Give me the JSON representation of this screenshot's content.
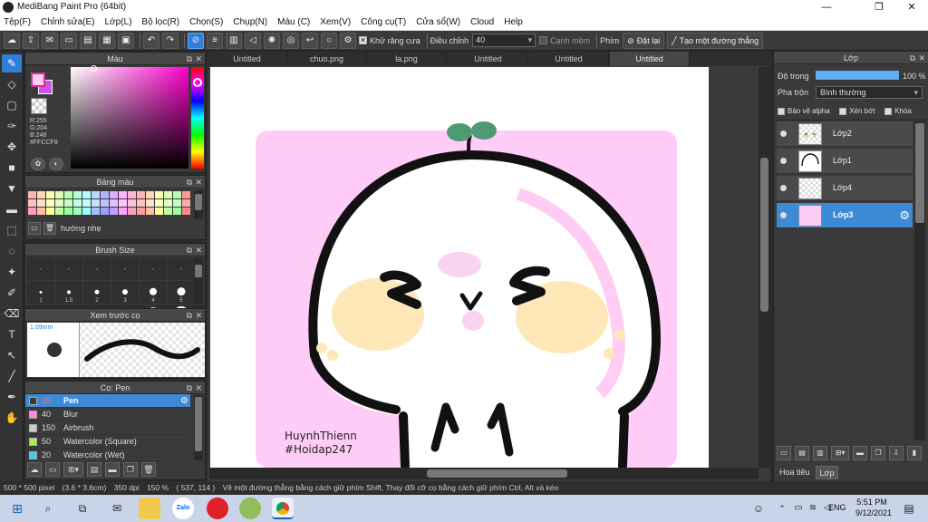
{
  "window": {
    "title": "MediBang Paint Pro (64bit)",
    "minimize": "—",
    "maximize": "❐",
    "close": "✕"
  },
  "menu": [
    "Tệp(F)",
    "Chỉnh sửa(E)",
    "Lớp(L)",
    "Bộ lọc(R)",
    "Chọn(S)",
    "Chụp(N)",
    "Màu (C)",
    "Xem(V)",
    "Công cụ(T)",
    "Cửa sổ(W)",
    "Cloud",
    "Help"
  ],
  "toolbar": {
    "antialias_label": "Khử răng cưa",
    "adjust_label": "Điều chỉnh",
    "adjust_value": "40",
    "snap_label": "Cạnh mềm",
    "snap_prefix": "Phím",
    "reset_label": "Đặt lại",
    "line_label": "Tạo một đường thẳng"
  },
  "color_panel": {
    "title": "Màu",
    "r": "R:255",
    "g": "G:204",
    "b": "B:248",
    "hex": "#FFCCF8",
    "fg_color": "#ffccf8"
  },
  "palette_panel": {
    "title": "Bảng màu",
    "name": "hướng nhẹ",
    "colors": [
      "#ffb3b3",
      "#ffd9b3",
      "#ffffb3",
      "#d9ffb3",
      "#b3ffb3",
      "#b3ffd9",
      "#b3ffff",
      "#b3d9ff",
      "#b3b3ff",
      "#d9b3ff",
      "#ffb3ff",
      "#ffb3d9",
      "#ffb3b3",
      "#ffd9b3",
      "#ffffb3",
      "#d9ffb3",
      "#b3ffb3",
      "#ff9999",
      "#ffc2c2",
      "#ffe0c2",
      "#ffffc2",
      "#e0ffc2",
      "#c2ffc2",
      "#c2ffe0",
      "#c2ffff",
      "#c2e0ff",
      "#c2c2ff",
      "#e0c2ff",
      "#ffc2ff",
      "#ffc2e0",
      "#ffc2c2",
      "#ffe0c2",
      "#ffffc2",
      "#e0ffc2",
      "#c2ffc2",
      "#ffaaaa",
      "#ff9fbf",
      "#ffbf9f",
      "#ffff9f",
      "#bfff9f",
      "#9fff9f",
      "#9fffbf",
      "#9fffff",
      "#9fbfff",
      "#9f9fff",
      "#bf9fff",
      "#ff9fff",
      "#ff9fbf",
      "#ff9f9f",
      "#ffbf9f",
      "#ffff9f",
      "#bfff9f",
      "#9fff9f",
      "#ff8888"
    ]
  },
  "brushsize_panel": {
    "title": "Brush Size",
    "sizes": [
      {
        "label": "",
        "d": 1
      },
      {
        "label": "",
        "d": 1
      },
      {
        "label": "",
        "d": 1
      },
      {
        "label": "",
        "d": 1
      },
      {
        "label": "",
        "d": 1
      },
      {
        "label": "",
        "d": 1
      },
      {
        "label": "1",
        "d": 3
      },
      {
        "label": "1.5",
        "d": 4
      },
      {
        "label": "2",
        "d": 5
      },
      {
        "label": "3",
        "d": 6
      },
      {
        "label": "4",
        "d": 8
      },
      {
        "label": "5",
        "d": 9
      },
      {
        "label": "",
        "d": 10
      },
      {
        "label": "",
        "d": 11
      },
      {
        "label": "",
        "d": 12
      },
      {
        "label": "",
        "d": 13
      },
      {
        "label": "",
        "d": 15
      },
      {
        "label": "",
        "d": 17
      }
    ]
  },
  "preview_panel": {
    "title": "Xem trước cọ",
    "size": "1.09mm"
  },
  "brush_panel": {
    "title": "Cọ: Pen",
    "items": [
      {
        "size": "15",
        "name": "Pen",
        "color": "#3a3a3a",
        "selected": true
      },
      {
        "size": "40",
        "name": "Blur",
        "color": "#ff88dd",
        "selected": false
      },
      {
        "size": "150",
        "name": "Airbrush",
        "color": "#cccccc",
        "selected": false
      },
      {
        "size": "50",
        "name": "Watercolor (Square)",
        "color": "#aaee55",
        "selected": false
      },
      {
        "size": "20",
        "name": "Watercolor (Wet)",
        "color": "#44ccee",
        "selected": false
      }
    ]
  },
  "tabs": [
    "Untitled",
    "chuo.png",
    "la.png",
    "Untitled",
    "Untitled",
    "Untitled"
  ],
  "active_tab": 5,
  "canvas": {
    "signature_line1": "HuynhThienn",
    "signature_line2": "#Hoidap247"
  },
  "layer_panel": {
    "title": "Lớp",
    "opacity_label": "Độ trong",
    "opacity_value": "100 %",
    "opacity": 1.0,
    "blend_label": "Pha trộn",
    "blend_value": "Bình thường",
    "protect_alpha": "Bảo vệ alpha",
    "clipping": "Xén bớt",
    "lock": "Khóa",
    "layers": [
      {
        "name": "Lớp2",
        "selected": false
      },
      {
        "name": "Lớp1",
        "selected": false
      },
      {
        "name": "Lớp4",
        "selected": false
      },
      {
        "name": "Lớp3",
        "selected": true
      }
    ],
    "bottom_tabs": [
      "Hoa tiêu",
      "Lớp"
    ]
  },
  "status": {
    "pixels": "500 * 500 pixel",
    "cm": "(3.6 * 3.6cm)",
    "dpi": "350 dpi",
    "zoom": "150 %",
    "coords": "( 537, 114 )",
    "hint": "Vẽ một đường thẳng bằng cách giữ phím Shift, Thay đổi cỡ cọ bằng cách giữ phím Ctrl, Alt và kéo"
  },
  "taskbar": {
    "lang": "ENG",
    "time": "5:51 PM",
    "date": "9/12/2021",
    "zalo": "Zalo"
  }
}
